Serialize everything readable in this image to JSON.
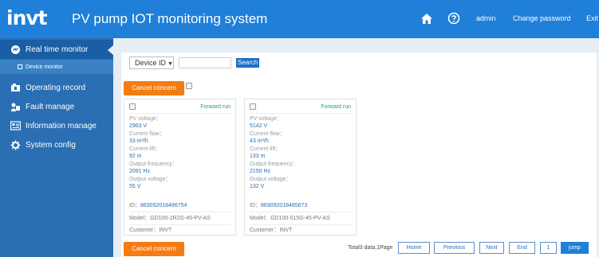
{
  "header": {
    "logo": "invt",
    "title": "PV pump IOT monitoring system",
    "home_icon": "home-icon",
    "help_icon": "help-icon",
    "user": "admin",
    "change_password": "Change password",
    "exit": "Exit"
  },
  "sidebar": {
    "items": [
      {
        "label": "Real time monitor",
        "icon": "monitor-icon"
      },
      {
        "label": "Operating record",
        "icon": "record-icon"
      },
      {
        "label": "Fault manage",
        "icon": "fault-icon"
      },
      {
        "label": "Information manage",
        "icon": "info-icon"
      },
      {
        "label": "System config",
        "icon": "config-icon"
      }
    ],
    "sub_item": "Device monitor"
  },
  "filters": {
    "select_value": "Device ID",
    "search_input_value": "",
    "search_button": "Search"
  },
  "actions": {
    "cancel_concern": "Cancel concern"
  },
  "cards": [
    {
      "status": "Forward run",
      "pv_voltage_label": "PV voltage：",
      "pv_voltage": "2963 V",
      "current_flow_label": "Current flow：",
      "current_flow": "33 m³/h",
      "current_lift_label": "Current lift：",
      "current_lift": "92 m",
      "output_frequency_label": "Output frequency：",
      "output_frequency": "2091 Hz",
      "output_voltage_label": "Output voltage：",
      "output_voltage": "55 V",
      "id_label": "ID：",
      "id": "863092018486754",
      "model_label": "Model：",
      "model": "GD100-2R2G-45-PV-AS",
      "customer_label": "Customer：",
      "customer": "INVT"
    },
    {
      "status": "Forward run",
      "pv_voltage_label": "PV voltage：",
      "pv_voltage": "5142 V",
      "current_flow_label": "Current flow：",
      "current_flow": "43 m³/h",
      "current_lift_label": "Current lift：",
      "current_lift": "133 m",
      "output_frequency_label": "Output frequency：",
      "output_frequency": "2150 Hz",
      "output_voltage_label": "Output voltage：",
      "output_voltage": "132 V",
      "id_label": "ID：",
      "id": "863092018485673",
      "model_label": "Model：",
      "model": "GD100-015G-45-PV-AS",
      "customer_label": "Customer：",
      "customer": "INVT"
    }
  ],
  "pagination": {
    "info": "Total3 data,1Page",
    "home": "Home",
    "previous": "Previous",
    "next": "Next",
    "end": "End",
    "page_input": "1",
    "jump": "jump"
  },
  "colors": {
    "header_bg": "#1f7fd9",
    "sidebar_bg": "#2a6eb3",
    "accent_orange": "#f47c11",
    "status_green": "#2aa35a",
    "value_blue": "#2a6eb3"
  }
}
